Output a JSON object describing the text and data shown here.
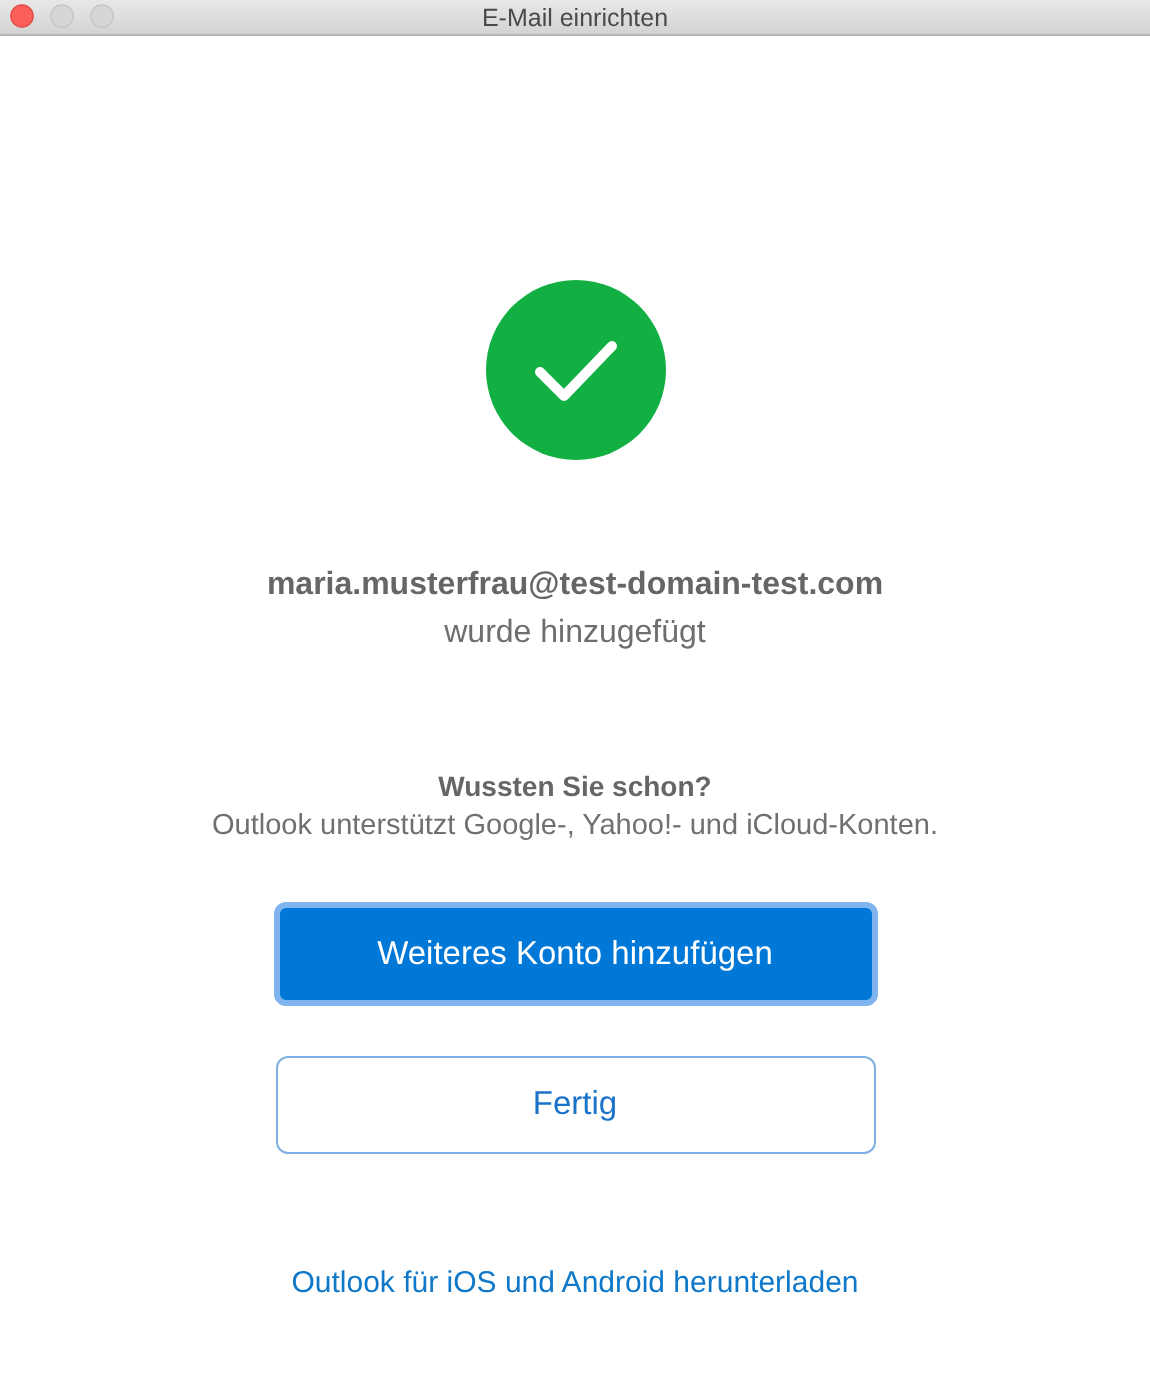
{
  "window": {
    "title": "E-Mail einrichten"
  },
  "success": {
    "email": "maria.musterfrau@test-domain-test.com",
    "message": "wurde hinzugefügt"
  },
  "tip": {
    "heading": "Wussten Sie schon?",
    "text": "Outlook unterstützt Google-, Yahoo!- und iCloud-Konten."
  },
  "buttons": [
    {
      "label": "Weiteres Konto hinzufügen",
      "kind": "primary"
    },
    {
      "label": "Fertig",
      "kind": "secondary"
    }
  ],
  "link": "Outlook für iOS und Android herunterladen"
}
